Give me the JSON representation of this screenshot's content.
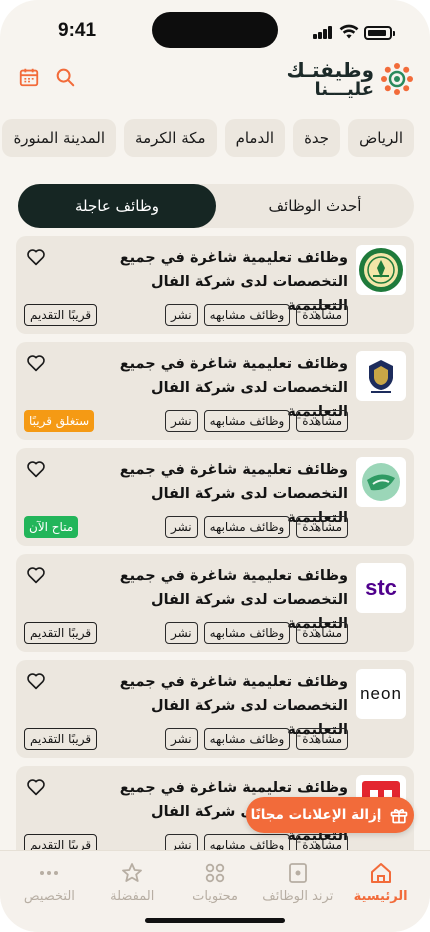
{
  "status_bar": {
    "time": "9:41"
  },
  "header": {
    "logo_line1": "وظيفتـك",
    "logo_line2": "عليـــنا",
    "colors": {
      "brand_orange": "#f26b3a",
      "brand_dark": "#162623"
    }
  },
  "cities": [
    "الرياض",
    "جدة",
    "الدمام",
    "مكة الكرمة",
    "المدينة المنورة"
  ],
  "tabs": [
    {
      "label": "وظائف عاجلة",
      "active": true
    },
    {
      "label": "أحدث الوظائف",
      "active": false
    }
  ],
  "jobs": [
    {
      "title": "وظائف تعليمية شاغرة في جميع التخصصات لدى شركة الفال التعليمية",
      "logo": "king-saud-university-logo",
      "tags": [
        "مشاهدة",
        "وظائف مشابهه",
        "نشر"
      ],
      "badge": "قريبًا التقديم",
      "badge_style": "outline"
    },
    {
      "title": "وظائف تعليمية شاغرة في جميع التخصصات لدى شركة الفال التعليمية",
      "logo": "security-academy-logo",
      "tags": [
        "مشاهدة",
        "وظائف مشابهه",
        "نشر"
      ],
      "badge": "ستغلق قريبًا",
      "badge_style": "orange"
    },
    {
      "title": "وظائف تعليمية شاغرة في جميع التخصصات لدى شركة الفال التعليمية",
      "logo": "green-globe-logo",
      "tags": [
        "مشاهدة",
        "وظائف مشابهه",
        "نشر"
      ],
      "badge": "متاح الآن",
      "badge_style": "green"
    },
    {
      "title": "وظائف تعليمية شاغرة في جميع التخصصات لدى شركة الفال التعليمية",
      "logo": "stc-logo",
      "logo_text": "stc",
      "tags": [
        "مشاهدة",
        "وظائف مشابهه",
        "نشر"
      ],
      "badge": "قريبًا التقديم",
      "badge_style": "outline"
    },
    {
      "title": "وظائف تعليمية شاغرة في جميع التخصصات لدى شركة الفال التعليمية",
      "logo": "neom-logo",
      "logo_text": "neon",
      "tags": [
        "مشاهدة",
        "وظائف مشابهه",
        "نشر"
      ],
      "badge": "قريبًا التقديم",
      "badge_style": "outline"
    },
    {
      "title": "وظائف تعليمية شاغرة في جميع التخصصات لدى شركة الفال التعليمية",
      "logo": "red-square-logo",
      "tags": [
        "مشاهدة",
        "وظائف مشابهه",
        "نشر"
      ],
      "badge": "قريبًا التقديم",
      "badge_style": "outline"
    }
  ],
  "remove_ads": {
    "label": "إزالة الإعلانات مجانًا",
    "icon": "gift-icon"
  },
  "bottom_nav": [
    {
      "label": "الرئيسية",
      "icon": "home-icon",
      "active": true
    },
    {
      "label": "ترند الوظائف",
      "icon": "trend-icon",
      "active": false
    },
    {
      "label": "محتويات",
      "icon": "grid-icon",
      "active": false
    },
    {
      "label": "المفضلة",
      "icon": "star-icon",
      "active": false
    },
    {
      "label": "التخصيص",
      "icon": "more-icon",
      "active": false
    }
  ]
}
